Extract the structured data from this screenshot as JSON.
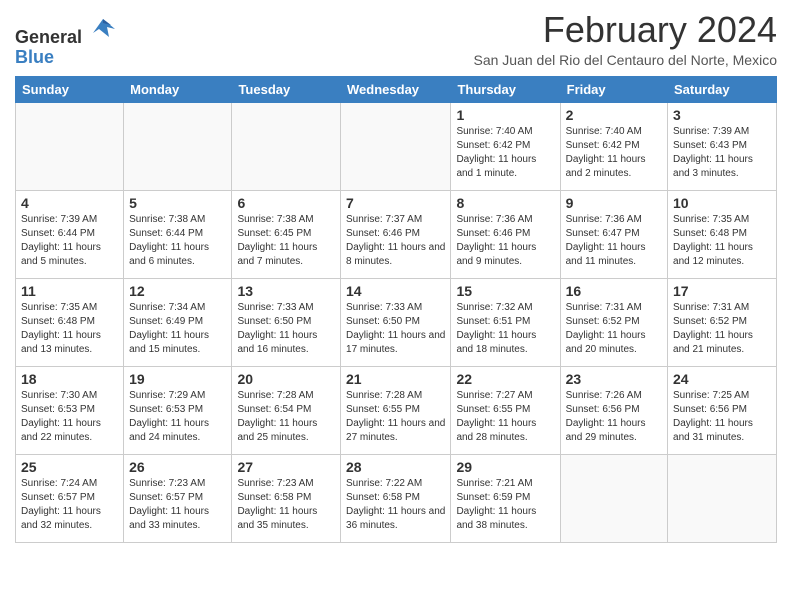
{
  "header": {
    "logo_general": "General",
    "logo_blue": "Blue",
    "title": "February 2024",
    "subtitle": "San Juan del Rio del Centauro del Norte, Mexico"
  },
  "weekdays": [
    "Sunday",
    "Monday",
    "Tuesday",
    "Wednesday",
    "Thursday",
    "Friday",
    "Saturday"
  ],
  "weeks": [
    [
      {
        "day": "",
        "info": ""
      },
      {
        "day": "",
        "info": ""
      },
      {
        "day": "",
        "info": ""
      },
      {
        "day": "",
        "info": ""
      },
      {
        "day": "1",
        "info": "Sunrise: 7:40 AM\nSunset: 6:42 PM\nDaylight: 11 hours and 1 minute."
      },
      {
        "day": "2",
        "info": "Sunrise: 7:40 AM\nSunset: 6:42 PM\nDaylight: 11 hours and 2 minutes."
      },
      {
        "day": "3",
        "info": "Sunrise: 7:39 AM\nSunset: 6:43 PM\nDaylight: 11 hours and 3 minutes."
      }
    ],
    [
      {
        "day": "4",
        "info": "Sunrise: 7:39 AM\nSunset: 6:44 PM\nDaylight: 11 hours and 5 minutes."
      },
      {
        "day": "5",
        "info": "Sunrise: 7:38 AM\nSunset: 6:44 PM\nDaylight: 11 hours and 6 minutes."
      },
      {
        "day": "6",
        "info": "Sunrise: 7:38 AM\nSunset: 6:45 PM\nDaylight: 11 hours and 7 minutes."
      },
      {
        "day": "7",
        "info": "Sunrise: 7:37 AM\nSunset: 6:46 PM\nDaylight: 11 hours and 8 minutes."
      },
      {
        "day": "8",
        "info": "Sunrise: 7:36 AM\nSunset: 6:46 PM\nDaylight: 11 hours and 9 minutes."
      },
      {
        "day": "9",
        "info": "Sunrise: 7:36 AM\nSunset: 6:47 PM\nDaylight: 11 hours and 11 minutes."
      },
      {
        "day": "10",
        "info": "Sunrise: 7:35 AM\nSunset: 6:48 PM\nDaylight: 11 hours and 12 minutes."
      }
    ],
    [
      {
        "day": "11",
        "info": "Sunrise: 7:35 AM\nSunset: 6:48 PM\nDaylight: 11 hours and 13 minutes."
      },
      {
        "day": "12",
        "info": "Sunrise: 7:34 AM\nSunset: 6:49 PM\nDaylight: 11 hours and 15 minutes."
      },
      {
        "day": "13",
        "info": "Sunrise: 7:33 AM\nSunset: 6:50 PM\nDaylight: 11 hours and 16 minutes."
      },
      {
        "day": "14",
        "info": "Sunrise: 7:33 AM\nSunset: 6:50 PM\nDaylight: 11 hours and 17 minutes."
      },
      {
        "day": "15",
        "info": "Sunrise: 7:32 AM\nSunset: 6:51 PM\nDaylight: 11 hours and 18 minutes."
      },
      {
        "day": "16",
        "info": "Sunrise: 7:31 AM\nSunset: 6:52 PM\nDaylight: 11 hours and 20 minutes."
      },
      {
        "day": "17",
        "info": "Sunrise: 7:31 AM\nSunset: 6:52 PM\nDaylight: 11 hours and 21 minutes."
      }
    ],
    [
      {
        "day": "18",
        "info": "Sunrise: 7:30 AM\nSunset: 6:53 PM\nDaylight: 11 hours and 22 minutes."
      },
      {
        "day": "19",
        "info": "Sunrise: 7:29 AM\nSunset: 6:53 PM\nDaylight: 11 hours and 24 minutes."
      },
      {
        "day": "20",
        "info": "Sunrise: 7:28 AM\nSunset: 6:54 PM\nDaylight: 11 hours and 25 minutes."
      },
      {
        "day": "21",
        "info": "Sunrise: 7:28 AM\nSunset: 6:55 PM\nDaylight: 11 hours and 27 minutes."
      },
      {
        "day": "22",
        "info": "Sunrise: 7:27 AM\nSunset: 6:55 PM\nDaylight: 11 hours and 28 minutes."
      },
      {
        "day": "23",
        "info": "Sunrise: 7:26 AM\nSunset: 6:56 PM\nDaylight: 11 hours and 29 minutes."
      },
      {
        "day": "24",
        "info": "Sunrise: 7:25 AM\nSunset: 6:56 PM\nDaylight: 11 hours and 31 minutes."
      }
    ],
    [
      {
        "day": "25",
        "info": "Sunrise: 7:24 AM\nSunset: 6:57 PM\nDaylight: 11 hours and 32 minutes."
      },
      {
        "day": "26",
        "info": "Sunrise: 7:23 AM\nSunset: 6:57 PM\nDaylight: 11 hours and 33 minutes."
      },
      {
        "day": "27",
        "info": "Sunrise: 7:23 AM\nSunset: 6:58 PM\nDaylight: 11 hours and 35 minutes."
      },
      {
        "day": "28",
        "info": "Sunrise: 7:22 AM\nSunset: 6:58 PM\nDaylight: 11 hours and 36 minutes."
      },
      {
        "day": "29",
        "info": "Sunrise: 7:21 AM\nSunset: 6:59 PM\nDaylight: 11 hours and 38 minutes."
      },
      {
        "day": "",
        "info": ""
      },
      {
        "day": "",
        "info": ""
      }
    ]
  ]
}
